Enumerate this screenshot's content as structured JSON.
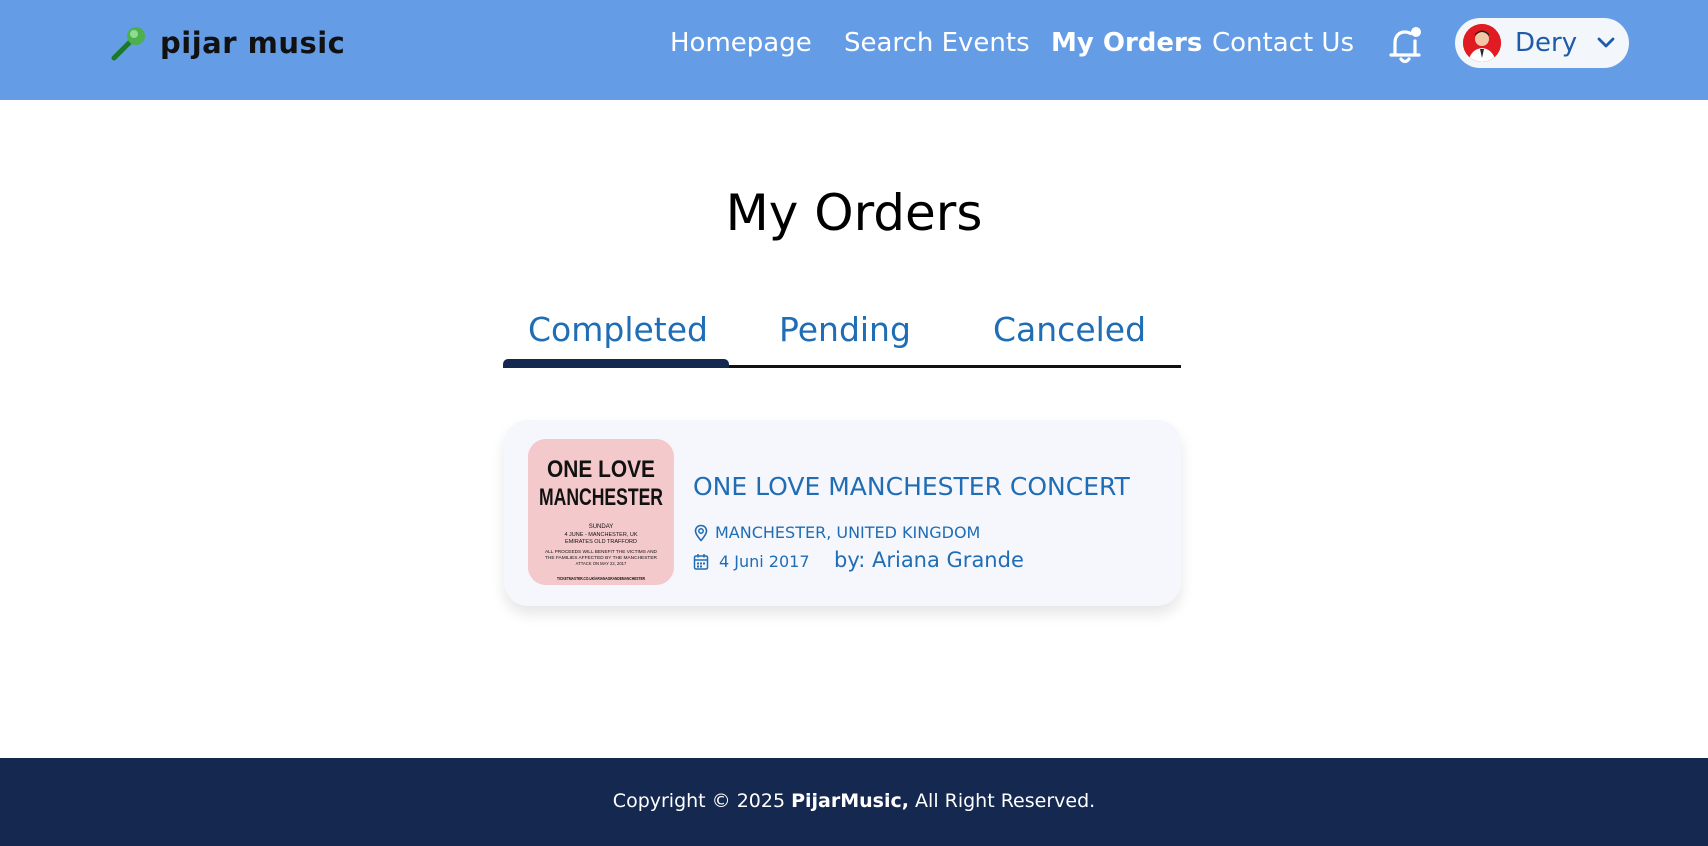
{
  "brand": {
    "name": "pijar music",
    "icon": "microphone-icon"
  },
  "nav": {
    "items": [
      {
        "label": "Homepage",
        "active": false
      },
      {
        "label": "Search Events",
        "active": false
      },
      {
        "label": "My Orders",
        "active": true
      },
      {
        "label": "Contact Us",
        "active": false
      }
    ],
    "notification_icon": "bell-icon"
  },
  "user": {
    "name": "Dery",
    "dropdown_icon": "chevron-down-icon"
  },
  "page": {
    "title": "My Orders"
  },
  "tabs": {
    "items": [
      {
        "label": "Completed",
        "active": true
      },
      {
        "label": "Pending",
        "active": false
      },
      {
        "label": "Canceled",
        "active": false
      }
    ]
  },
  "orders": [
    {
      "title": "ONE LOVE MANCHESTER CONCERT",
      "location": "MANCHESTER, UNITED KINGDOM",
      "date": "4 Juni 2017",
      "by": "by: Ariana Grande",
      "poster": {
        "line1": "ONE LOVE",
        "line2": "MANCHESTER",
        "day": "SUNDAY",
        "details1": "4 JUNE - MANCHESTER, UK",
        "details2": "EMIRATES OLD TRAFFORD",
        "note1": "ALL PROCEEDS WILL BENEFIT THE VICTIMS AND",
        "note2": "THE FAMILIES AFFECTED BY THE MANCHESTER",
        "note3": "ATTACK ON MAY 22, 2017",
        "site": "TICKETMASTER.CO.UK/ARIANAGRANDEMANCHESTER"
      }
    }
  ],
  "footer": {
    "prefix": "Copyright © 2025 ",
    "brand": "PijarMusic,",
    "suffix": " All Right Reserved."
  },
  "colors": {
    "header_bg": "#659ce6",
    "accent_text": "#1f6db5",
    "footer_bg": "#142850",
    "tab_indicator": "#142850",
    "poster_bg": "#f4c9cb"
  }
}
